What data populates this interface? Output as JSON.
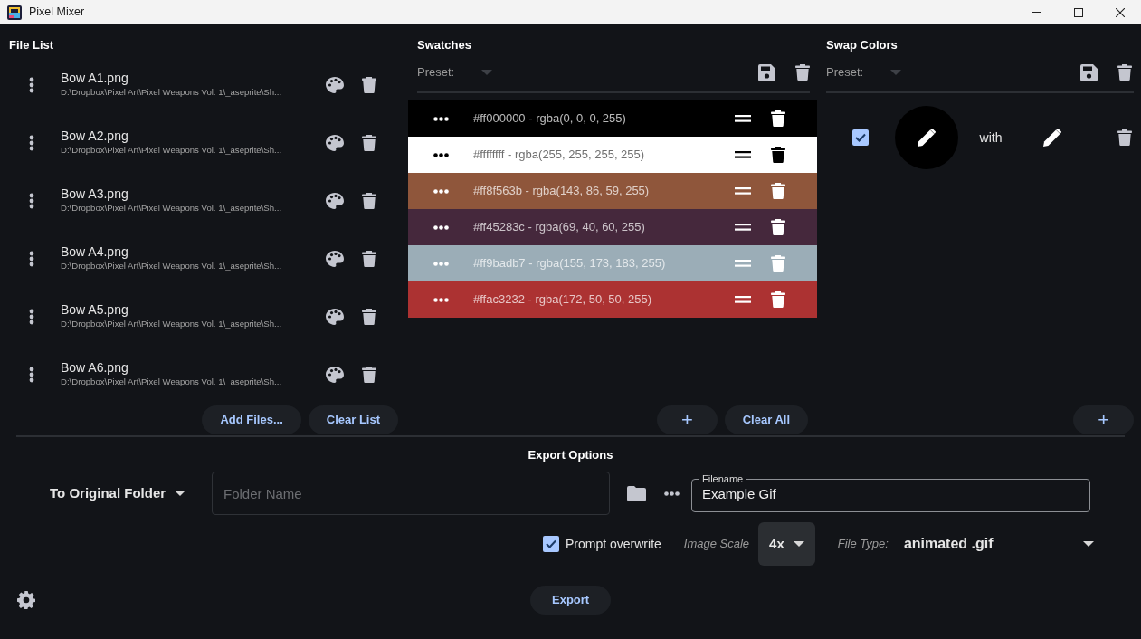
{
  "window": {
    "title": "Pixel Mixer"
  },
  "file_list": {
    "title": "File List",
    "files": [
      {
        "name": "Bow A1.png",
        "path": "D:\\Dropbox\\Pixel Art\\Pixel Weapons Vol. 1\\_aseprite\\Sh..."
      },
      {
        "name": "Bow A2.png",
        "path": "D:\\Dropbox\\Pixel Art\\Pixel Weapons Vol. 1\\_aseprite\\Sh..."
      },
      {
        "name": "Bow A3.png",
        "path": "D:\\Dropbox\\Pixel Art\\Pixel Weapons Vol. 1\\_aseprite\\Sh..."
      },
      {
        "name": "Bow A4.png",
        "path": "D:\\Dropbox\\Pixel Art\\Pixel Weapons Vol. 1\\_aseprite\\Sh..."
      },
      {
        "name": "Bow A5.png",
        "path": "D:\\Dropbox\\Pixel Art\\Pixel Weapons Vol. 1\\_aseprite\\Sh..."
      },
      {
        "name": "Bow A6.png",
        "path": "D:\\Dropbox\\Pixel Art\\Pixel Weapons Vol. 1\\_aseprite\\Sh..."
      }
    ],
    "buttons": [
      "Add Files...",
      "Clear List"
    ]
  },
  "swatches": {
    "title": "Swatches",
    "preset_label": "Preset:",
    "items": [
      {
        "label": "#ff000000 - rgba(0, 0, 0, 255)",
        "color": "#000000"
      },
      {
        "label": "#ffffffff - rgba(255, 255, 255, 255)",
        "color": "#ffffff"
      },
      {
        "label": "#ff8f563b - rgba(143, 86, 59, 255)",
        "color": "#8f563b"
      },
      {
        "label": "#ff45283c - rgba(69, 40, 60, 255)",
        "color": "#45283c"
      },
      {
        "label": "#ff9badb7 - rgba(155, 173, 183, 255)",
        "color": "#9badb7"
      },
      {
        "label": "#ffac3232 - rgba(172, 50, 50, 255)",
        "color": "#ac3232"
      }
    ],
    "add_button": "+",
    "clear_button": "Clear All"
  },
  "swap_colors": {
    "title": "Swap Colors",
    "preset_label": "Preset:",
    "rows": [
      {
        "checked": true,
        "color": "#000000",
        "with_label": "with"
      }
    ],
    "add_button": "+"
  },
  "export": {
    "title": "Export Options",
    "destination": "To Original Folder",
    "folder_placeholder": "Folder Name",
    "filename_label": "Filename",
    "filename": "Example Gif",
    "prompt_overwrite": {
      "label": "Prompt overwrite",
      "checked": true
    },
    "scale_label": "Image Scale",
    "scale": "4x",
    "file_type_label": "File Type:",
    "file_type": "animated .gif",
    "export_button": "Export"
  }
}
